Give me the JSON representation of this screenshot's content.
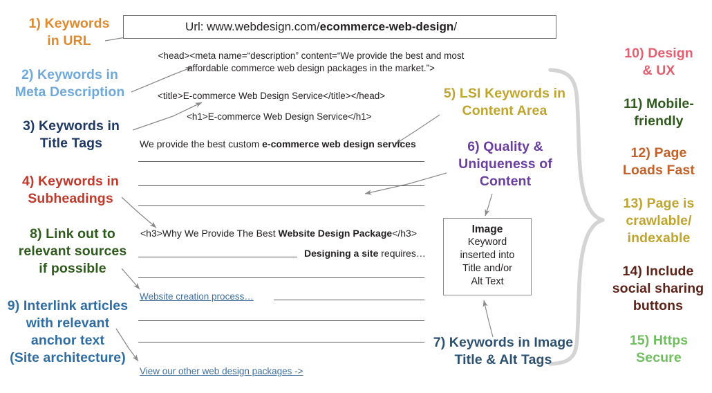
{
  "page": {
    "title": "On-Page SEO Checklist Diagram",
    "background": "#ffffff"
  },
  "mock_page": {
    "url_bar": {
      "prefix": "Url: www.webdesign.com/",
      "keyword": "ecommerce-web-design",
      "suffix": "/"
    },
    "meta_line": "<head><meta name=“description” content=“We provide the best and most\naffordable commerce web design packages in the market.”>",
    "title_line": "<title>E-commerce Web Design Service</title></head>",
    "h1_line": "<h1>E-commerce Web Design Service</h1>",
    "intro_plain": "We provide the best custom ",
    "intro_bold": "e-commerce web design services",
    "h3_open": "<h3>Why We Provide The Best ",
    "h3_bold": "Website Design Package",
    "h3_close": "</h3>",
    "designing_bold": "Designing a site",
    "designing_plain": " requires…",
    "inline_link": "Website creation process…",
    "bottom_link": "View our other web design packages ->",
    "image_box": {
      "title": "Image",
      "body": "Keyword\ninserted into\nTitle and/or\nAlt Text"
    }
  },
  "annotations": [
    {
      "id": 1,
      "text": "1) Keywords\nin URL",
      "color": "#E08A2E"
    },
    {
      "id": 2,
      "text": "2) Keywords in\nMeta Description",
      "color": "#6FA9DB"
    },
    {
      "id": 3,
      "text": "3) Keywords in\nTitle Tags",
      "color": "#1F3864"
    },
    {
      "id": 4,
      "text": "4) Keywords in\nSubheadings",
      "color": "#C0392B"
    },
    {
      "id": 5,
      "text": "5) LSI Keywords in\nContent Area",
      "color": "#BFA52E"
    },
    {
      "id": 6,
      "text": "6) Quality &\nUniqueness of\nContent",
      "color": "#6B3FA0"
    },
    {
      "id": 7,
      "text": "7) Keywords in Image\nTitle & Alt Tags",
      "color": "#2C5070"
    },
    {
      "id": 8,
      "text": "8) Link out to\nrelevant sources\nif possible",
      "color": "#2E5A1C"
    },
    {
      "id": 9,
      "text": "9) Interlink articles\nwith relevant\nanchor text\n(Site architecture)",
      "color": "#2E6DA4"
    },
    {
      "id": 10,
      "text": "10) Design\n& UX",
      "color": "#E06070"
    },
    {
      "id": 11,
      "text": "11) Mobile-\nfriendly",
      "color": "#2E5A1C"
    },
    {
      "id": 12,
      "text": "12) Page\nLoads Fast",
      "color": "#C2622A"
    },
    {
      "id": 13,
      "text": "13) Page is\ncrawlable/\nindexable",
      "color": "#BFA52E"
    },
    {
      "id": 14,
      "text": "14) Include\nsocial sharing\nbuttons",
      "color": "#5C2318"
    },
    {
      "id": 15,
      "text": "15) Https\nSecure",
      "color": "#6FBF5E"
    }
  ],
  "graphics": {
    "arrow_color": "#8a8a8a",
    "brace_color": "#d4d4d4",
    "rule_color": "#5d5d5d",
    "box_border": "#6d6d6d"
  }
}
